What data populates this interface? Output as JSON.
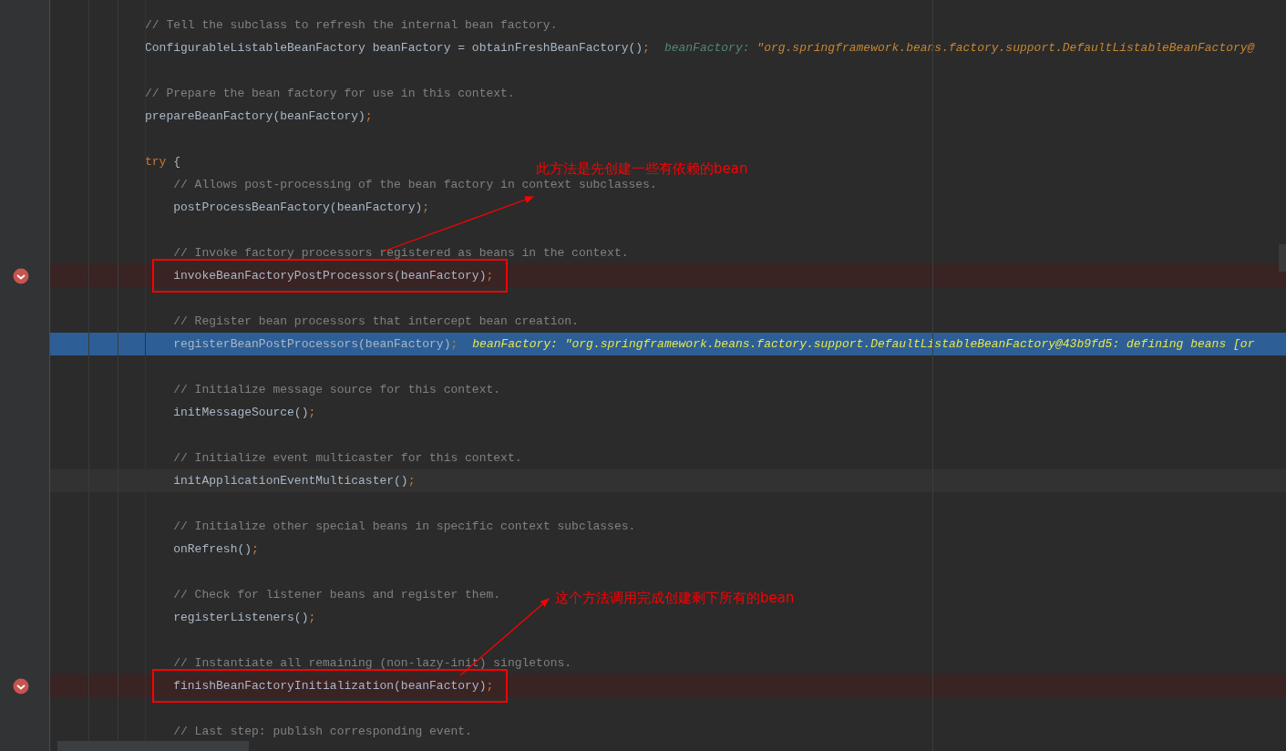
{
  "blocks": [
    {
      "lines": [
        {
          "segments": [
            {
              "kind": "comment",
              "text": "// Tell the subclass to refresh the internal bean factory."
            }
          ]
        },
        {
          "segments": [
            {
              "kind": "plain",
              "text": "ConfigurableListableBeanFactory beanFactory = obtainFreshBeanFactory()"
            },
            {
              "kind": "punct",
              "text": ";"
            }
          ],
          "hint": {
            "name": "beanFactory: ",
            "value": "\"org.springframework.beans.factory.support.DefaultListableBeanFactory@"
          }
        }
      ]
    },
    {
      "lines": [
        {
          "segments": [
            {
              "kind": "comment",
              "text": "// Prepare the bean factory for use in this context."
            }
          ]
        },
        {
          "segments": [
            {
              "kind": "plain",
              "text": "prepareBeanFactory(beanFactory)"
            },
            {
              "kind": "punct",
              "text": ";"
            }
          ]
        }
      ]
    },
    {
      "lines": [
        {
          "segments": [
            {
              "kind": "keyword",
              "text": "try"
            },
            {
              "kind": "plain",
              "text": " {"
            }
          ]
        },
        {
          "segments": [
            {
              "kind": "comment",
              "text": "    // Allows post-processing of the bean factory in context subclasses."
            }
          ]
        },
        {
          "segments": [
            {
              "kind": "plain",
              "text": "    postProcessBeanFactory(beanFactory)"
            },
            {
              "kind": "punct",
              "text": ";"
            }
          ]
        }
      ]
    },
    {
      "lines": [
        {
          "segments": [
            {
              "kind": "comment",
              "text": "    // Invoke factory processors registered as beans in the context."
            }
          ]
        },
        {
          "breakpoint": true,
          "framed": true,
          "segments": [
            {
              "kind": "plain",
              "text": "    invokeBeanFactoryPostProcessors(beanFactory)"
            },
            {
              "kind": "punct",
              "text": ";"
            }
          ]
        }
      ]
    },
    {
      "lines": [
        {
          "segments": [
            {
              "kind": "comment",
              "text": "    // Register bean processors that intercept bean creation."
            }
          ]
        },
        {
          "execution_point": true,
          "segments": [
            {
              "kind": "plain",
              "text": "    registerBeanPostProcessors(beanFactory)"
            },
            {
              "kind": "punct",
              "text": ";"
            }
          ],
          "hint": {
            "name": "beanFactory: ",
            "value": "\"org.springframework.beans.factory.support.DefaultListableBeanFactory@43b9fd5: defining beans [or"
          }
        }
      ]
    },
    {
      "lines": [
        {
          "segments": [
            {
              "kind": "comment",
              "text": "    // Initialize message source for this context."
            }
          ]
        },
        {
          "segments": [
            {
              "kind": "plain",
              "text": "    initMessageSource()"
            },
            {
              "kind": "punct",
              "text": ";"
            }
          ]
        }
      ]
    },
    {
      "lines": [
        {
          "segments": [
            {
              "kind": "comment",
              "text": "    // Initialize event multicaster for this context."
            }
          ]
        },
        {
          "caret": true,
          "segments": [
            {
              "kind": "plain",
              "text": "    initApplicationEventMulticaster()"
            },
            {
              "kind": "punct",
              "text": ";"
            }
          ]
        }
      ]
    },
    {
      "lines": [
        {
          "segments": [
            {
              "kind": "comment",
              "text": "    // Initialize other special beans in specific context subclasses."
            }
          ]
        },
        {
          "segments": [
            {
              "kind": "plain",
              "text": "    onRefresh()"
            },
            {
              "kind": "punct",
              "text": ";"
            }
          ]
        }
      ]
    },
    {
      "lines": [
        {
          "segments": [
            {
              "kind": "comment",
              "text": "    // Check for listener beans and register them."
            }
          ]
        },
        {
          "segments": [
            {
              "kind": "plain",
              "text": "    registerListeners()"
            },
            {
              "kind": "punct",
              "text": ";"
            }
          ]
        }
      ]
    },
    {
      "lines": [
        {
          "segments": [
            {
              "kind": "comment",
              "text": "    // Instantiate all remaining (non-lazy-init) singletons."
            }
          ]
        },
        {
          "breakpoint": true,
          "framed": true,
          "segments": [
            {
              "kind": "plain",
              "text": "    finishBeanFactoryInitialization(beanFactory)"
            },
            {
              "kind": "punct",
              "text": ";"
            }
          ]
        }
      ]
    },
    {
      "lines": [
        {
          "segments": [
            {
              "kind": "comment",
              "text": "    // Last step: publish corresponding event."
            }
          ]
        }
      ]
    }
  ],
  "annotations": [
    {
      "text": "此方法是先创建一些有依赖的bean"
    },
    {
      "text": "这个方法调用完成创建剩下所有的bean"
    }
  ]
}
